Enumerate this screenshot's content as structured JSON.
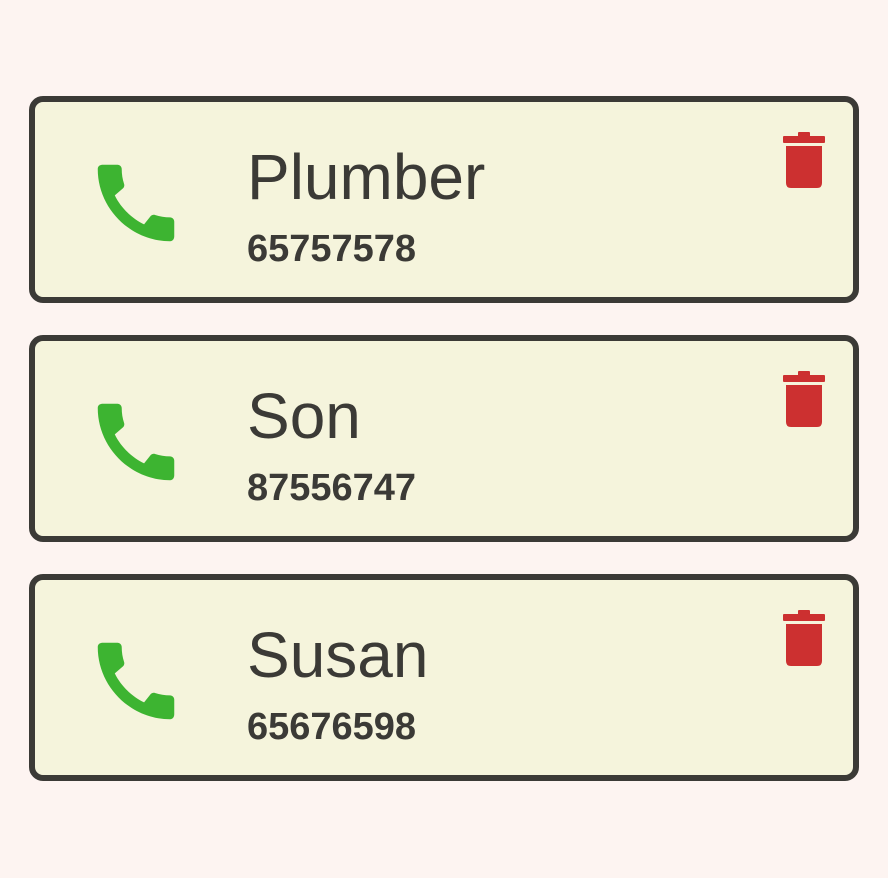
{
  "theme": {
    "page_bg": "#fdf4f1",
    "card_bg": "#f5f4dc",
    "card_border": "#3b3a36",
    "text_color": "#3b3a36",
    "call_icon_color": "#3db431",
    "delete_icon_color": "#cc3030"
  },
  "contacts": [
    {
      "name": "Plumber",
      "number": "65757578",
      "call_icon": "phone-icon",
      "delete_icon": "trash-icon"
    },
    {
      "name": "Son",
      "number": "87556747",
      "call_icon": "phone-icon",
      "delete_icon": "trash-icon"
    },
    {
      "name": "Susan",
      "number": "65676598",
      "call_icon": "phone-icon",
      "delete_icon": "trash-icon"
    }
  ]
}
